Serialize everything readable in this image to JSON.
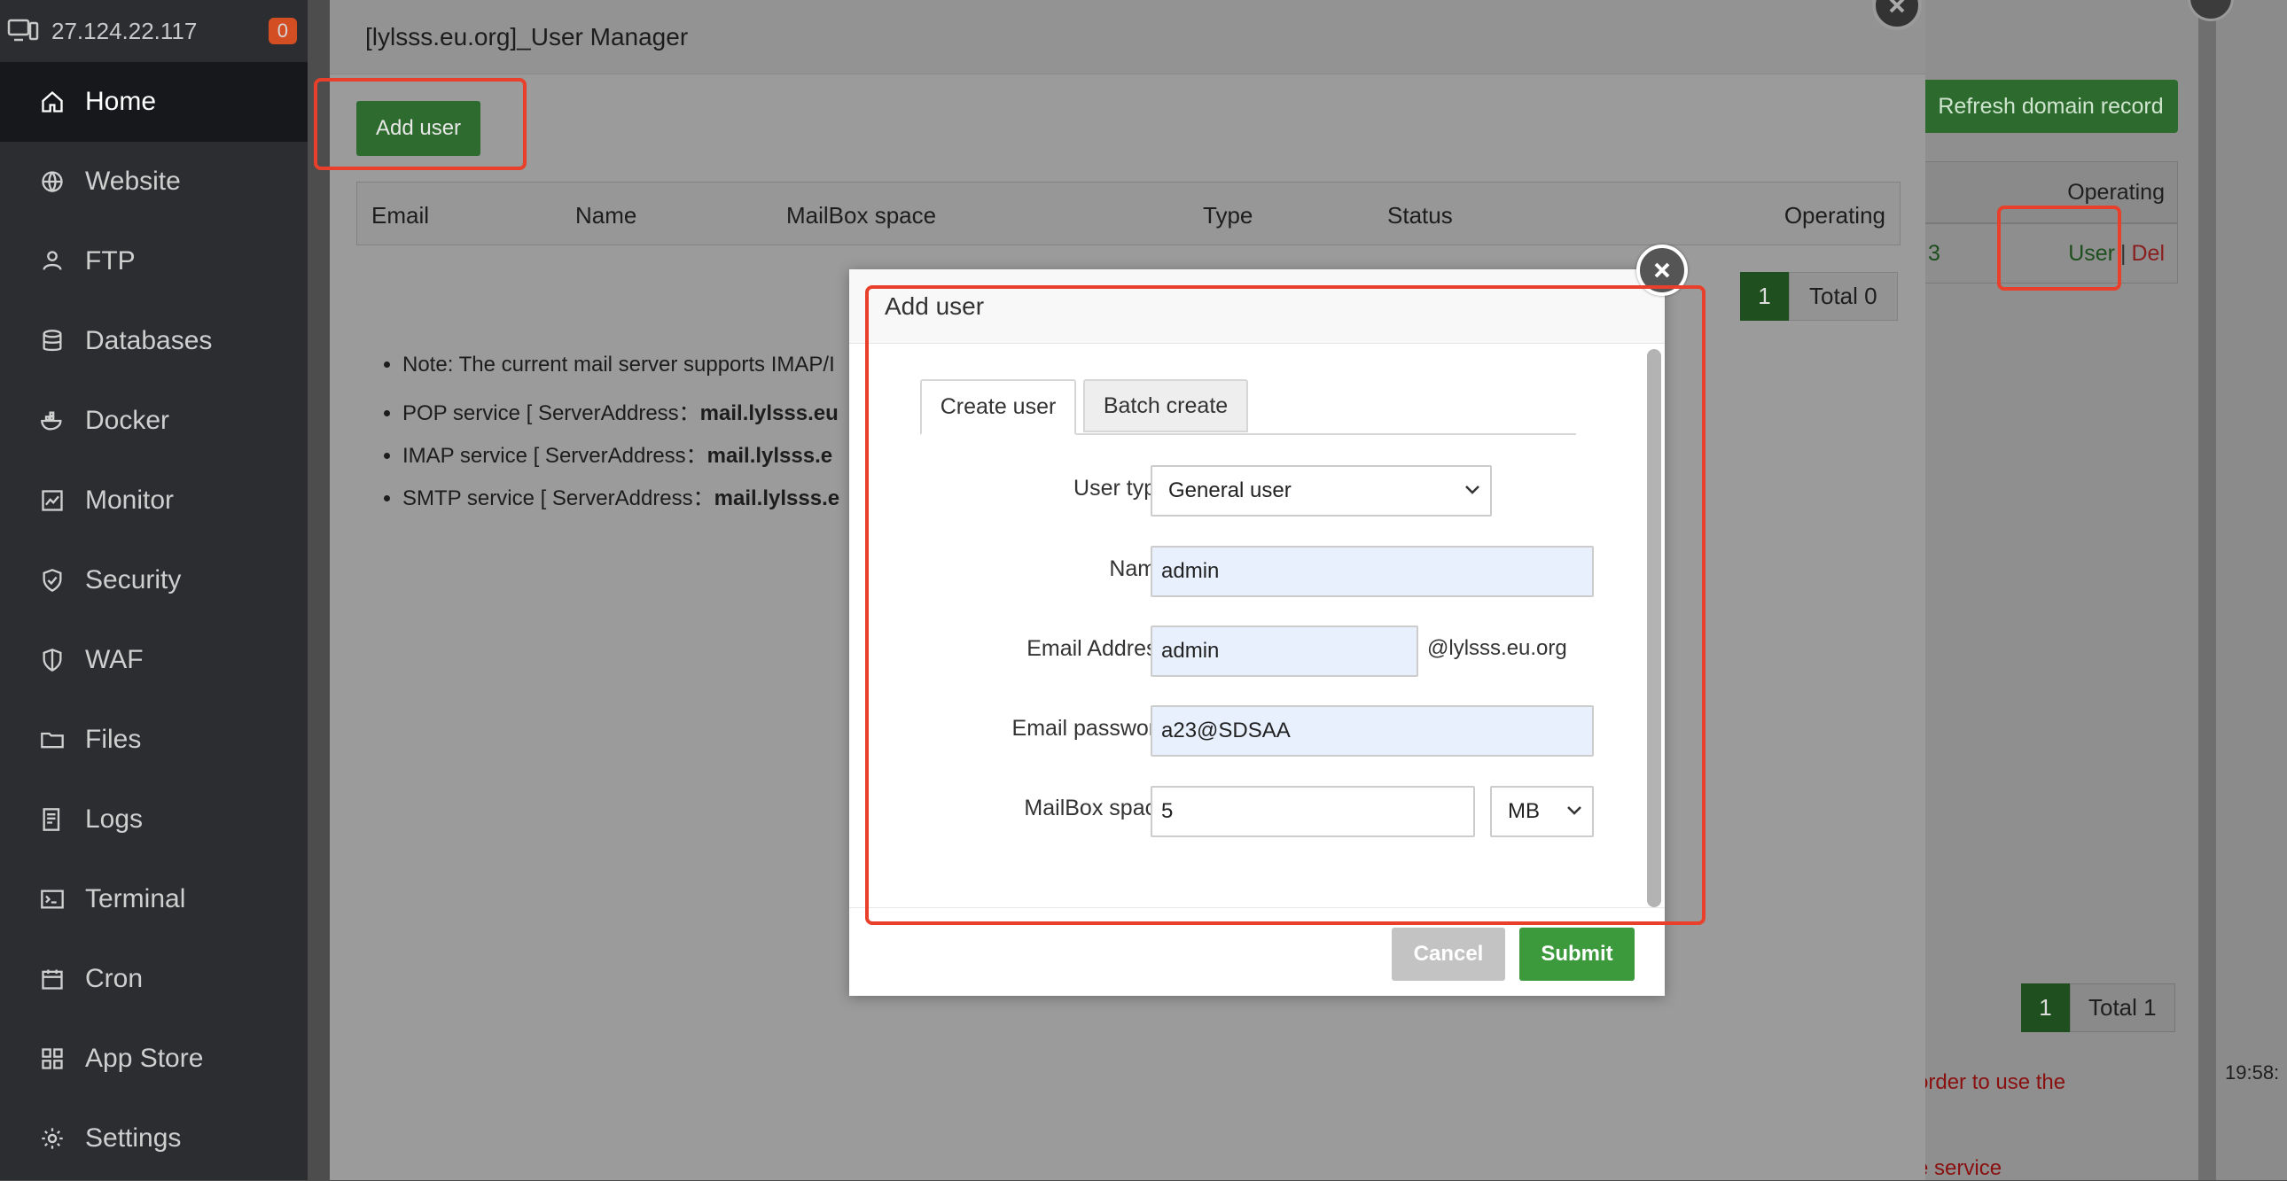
{
  "sidebar": {
    "server_ip": "27.124.22.117",
    "badge_count": "0",
    "items": [
      {
        "label": "Home",
        "icon": "home-icon"
      },
      {
        "label": "Website",
        "icon": "globe-icon"
      },
      {
        "label": "FTP",
        "icon": "ftp-icon"
      },
      {
        "label": "Databases",
        "icon": "database-icon"
      },
      {
        "label": "Docker",
        "icon": "docker-icon"
      },
      {
        "label": "Monitor",
        "icon": "monitor-icon"
      },
      {
        "label": "Security",
        "icon": "shield-icon"
      },
      {
        "label": "WAF",
        "icon": "waf-shield-icon"
      },
      {
        "label": "Files",
        "icon": "folder-icon"
      },
      {
        "label": "Logs",
        "icon": "logs-icon"
      },
      {
        "label": "Terminal",
        "icon": "terminal-icon"
      },
      {
        "label": "Cron",
        "icon": "calendar-icon"
      },
      {
        "label": "App Store",
        "icon": "grid-icon"
      },
      {
        "label": "Settings",
        "icon": "gear-icon"
      }
    ]
  },
  "background": {
    "refresh_label": "Refresh domain record",
    "operating_header": "Operating",
    "row_num": "3",
    "user_link": "User",
    "separator": "|",
    "del_link": "Del",
    "pager_current": "1",
    "pager_total": "Total 1",
    "warn_text": "order to use the",
    "warn_text2": "e service",
    "time_label": "19:58:"
  },
  "user_manager": {
    "title": "[lylsss.eu.org]_User Manager",
    "add_user_label": "Add user",
    "columns": [
      "Email",
      "Name",
      "MailBox space",
      "Type",
      "Status",
      "Operating"
    ],
    "pager_current": "1",
    "pager_total": "Total 0",
    "notes": [
      {
        "prefix": "Note: The current mail server supports IMAP/I",
        "bold": ""
      },
      {
        "prefix": "POP service [ ServerAddress：",
        "bold": "mail.lylsss.eu"
      },
      {
        "prefix": "IMAP service [ ServerAddress：",
        "bold": "mail.lylsss.e"
      },
      {
        "prefix": "SMTP service [ ServerAddress：",
        "bold": "mail.lylsss.e"
      }
    ]
  },
  "add_user_dialog": {
    "title": "Add user",
    "tabs": [
      "Create user",
      "Batch create"
    ],
    "fields": {
      "user_type_label": "User type",
      "user_type_value": "General user",
      "name_label": "Name",
      "name_value": "admin",
      "email_label": "Email Address",
      "email_value": "admin",
      "email_suffix": "@lylsss.eu.org",
      "password_label": "Email password",
      "password_value": "a23@SDSAA",
      "mailbox_label": "MailBox space",
      "mailbox_value": "5",
      "mailbox_unit": "MB"
    },
    "cancel_label": "Cancel",
    "submit_label": "Submit"
  },
  "colors": {
    "primary_green": "#3c9a3c",
    "annotation_red": "#e8402a",
    "sidebar_bg": "#2b2d31",
    "input_filled_bg": "#e8f0fe"
  }
}
